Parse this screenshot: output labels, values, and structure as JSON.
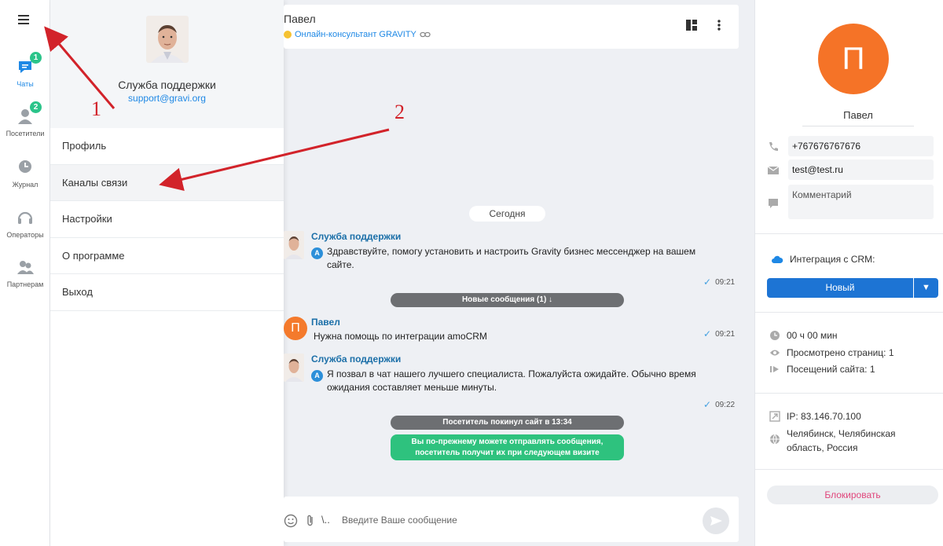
{
  "rail": {
    "items": [
      {
        "label": "Чаты",
        "badge": "1"
      },
      {
        "label": "Посетители",
        "badge": "2"
      },
      {
        "label": "Журнал"
      },
      {
        "label": "Операторы"
      },
      {
        "label": "Партнерам"
      }
    ]
  },
  "drawer": {
    "name": "Служба поддержки",
    "email": "support@gravi.org",
    "menu": [
      "Профиль",
      "Каналы связи",
      "Настройки",
      "О программе",
      "Выход"
    ]
  },
  "chat": {
    "visitor_name": "Павел",
    "channel": "Онлайн-консультант GRAVITY",
    "date_divider": "Сегодня",
    "messages": [
      {
        "author": "Служба поддержки",
        "text": "Здравствуйте, помогу установить и настроить Gravity бизнес мессенджер на вашем сайте.",
        "time": "09:21",
        "badge": "A"
      },
      {
        "author": "Павел",
        "text": "Нужна помощь по интеграции amoCRM",
        "time": "09:21",
        "avatar_letter": "П"
      },
      {
        "author": "Служба поддержки",
        "text": "Я позвал в чат нашего лучшего специалиста. Пожалуйста ожидайте. Обычно время ожидания составляет меньше минуты.",
        "time": "09:22",
        "badge": "A"
      }
    ],
    "new_messages_label": "Новые сообщения (1) ↓",
    "left_site_label": "Посетитель покинул сайт в 13:34",
    "notice": {
      "line1": "Вы по-прежнему можете отправлять сообщения,",
      "line2": "посетитель получит их при следующем визите"
    },
    "composer_placeholder": "Введите Ваше сообщение",
    "format_label": "\\.."
  },
  "panel": {
    "avatar_letter": "П",
    "name": "Павел",
    "phone": "+767676767676",
    "email": "test@test.ru",
    "comment_placeholder": "Комментарий",
    "crm_label": "Интеграция с CRM:",
    "crm_value": "Новый",
    "crm_arrow": "▼",
    "time_on_site": "00 ч 00 мин",
    "pages_viewed": "Просмотрено страниц: 1",
    "visits": "Посещений сайта: 1",
    "ip": "IP: 83.146.70.100",
    "location_line1": "Челябинск, Челябинская",
    "location_line2": "область, Россия",
    "block_label": "Блокировать"
  },
  "annotations": {
    "label_1": "1",
    "label_2": "2"
  },
  "colors": {
    "accent": "#1e88e5",
    "badge": "#2bc48a",
    "visitor": "#f57327",
    "arrow": "#d2232a"
  }
}
